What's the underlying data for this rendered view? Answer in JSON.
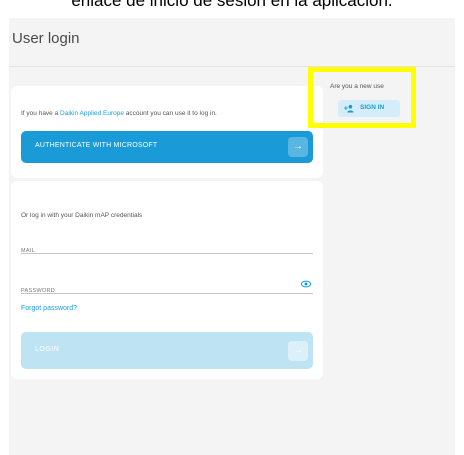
{
  "caption": "enlace de inicio de sesión en la aplicación.",
  "page": {
    "title": "User login"
  },
  "microsoft_card": {
    "info_prefix": "If you have a ",
    "info_link": "Daikin Applied Europe",
    "info_suffix": " account you can use it to log in.",
    "button_label": "AUTHENTICATE WITH MICROSOFT"
  },
  "credentials_card": {
    "info": "Or log in with your Daikin mAP credentials",
    "mail_placeholder": "MAIL",
    "password_placeholder": "PASSWORD",
    "forgot_label": "Forgot password?",
    "login_label": "LOGIN"
  },
  "new_user": {
    "prompt": "Are you a new use",
    "signin_label": "SIGN IN"
  },
  "colors": {
    "accent": "#1a9ad6",
    "highlight": "#ffff00",
    "login_disabled": "#bee4f4"
  },
  "icons": {
    "arrow": "arrow-right-icon",
    "eye": "eye-icon",
    "signin": "add-user-icon"
  }
}
